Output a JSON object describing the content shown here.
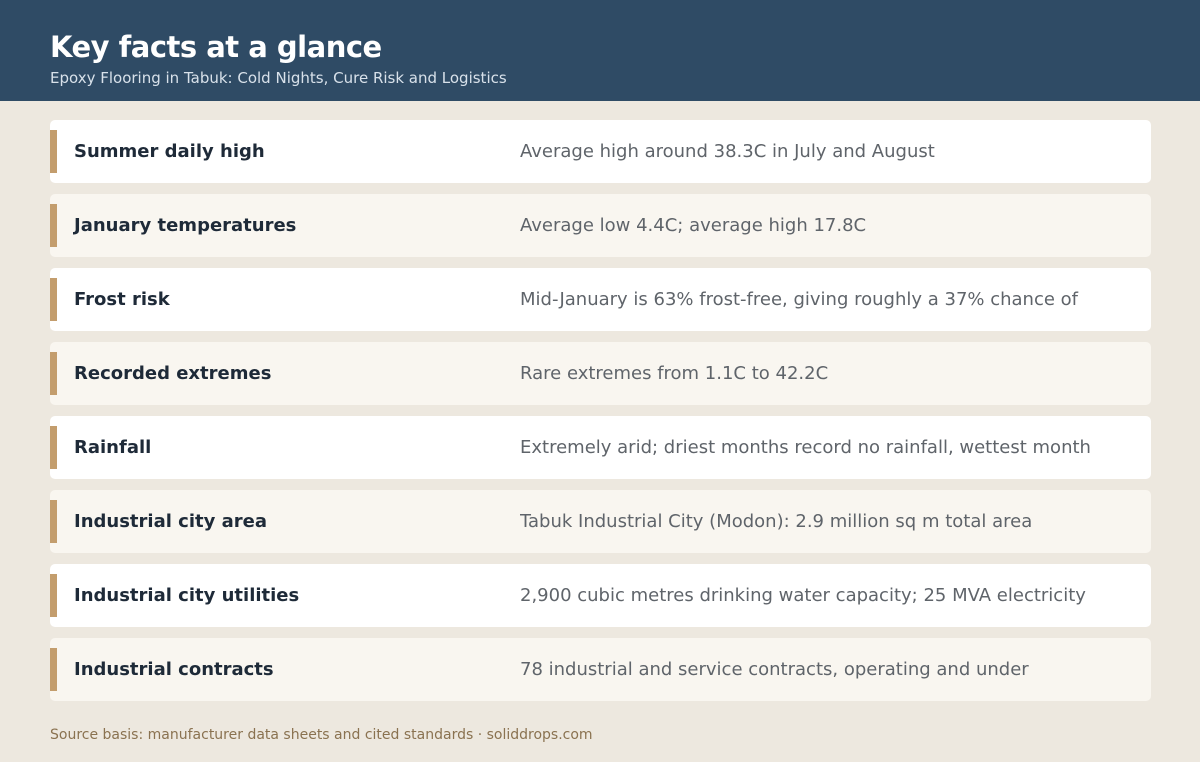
{
  "header": {
    "title": "Key facts at a glance",
    "subtitle": "Epoxy Flooring in Tabuk: Cold Nights, Cure Risk and Logistics"
  },
  "facts": [
    {
      "label": "Summer daily high",
      "value": "Average high around 38.3C in July and August"
    },
    {
      "label": "January temperatures",
      "value": "Average low 4.4C; average high 17.8C"
    },
    {
      "label": "Frost risk",
      "value": "Mid-January is 63% frost-free, giving roughly a 37% chance of"
    },
    {
      "label": "Recorded extremes",
      "value": "Rare extremes from 1.1C to 42.2C"
    },
    {
      "label": "Rainfall",
      "value": "Extremely arid; driest months record no rainfall, wettest month"
    },
    {
      "label": "Industrial city area",
      "value": "Tabuk Industrial City (Modon): 2.9 million sq m total area"
    },
    {
      "label": "Industrial city utilities",
      "value": "2,900 cubic metres drinking water capacity; 25 MVA electricity"
    },
    {
      "label": "Industrial contracts",
      "value": "78 industrial and service contracts, operating and under"
    }
  ],
  "footer": {
    "source": "Source basis: manufacturer data sheets and cited standards · soliddrops.com"
  },
  "colors": {
    "header_bg": "#2f4b65",
    "page_bg": "#ede8df",
    "accent": "#c39d6d"
  }
}
